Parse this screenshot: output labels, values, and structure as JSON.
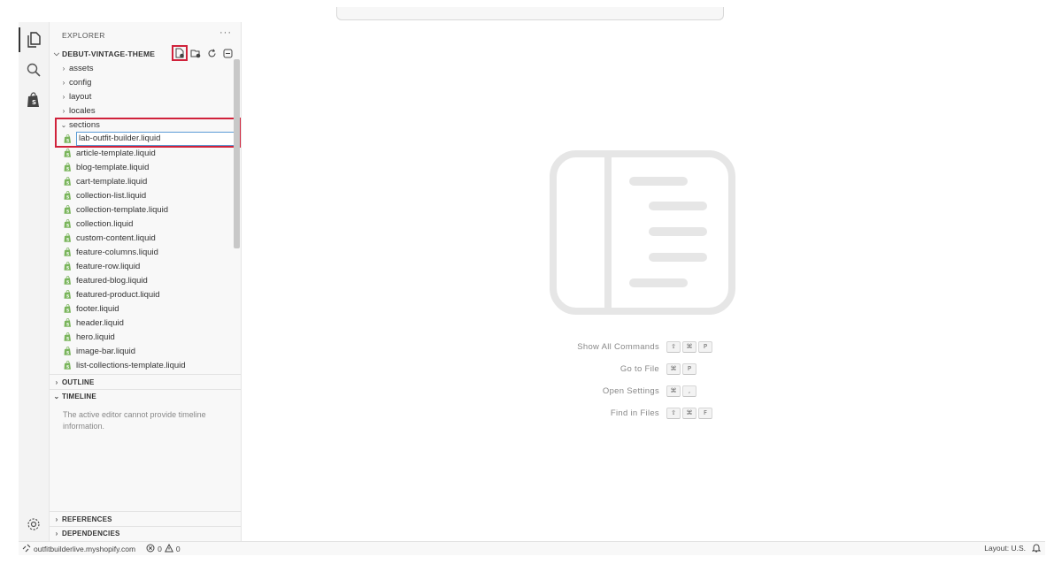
{
  "explorer": {
    "title": "EXPLORER",
    "more": "···",
    "project": "DEBUT-VINTAGE-THEME",
    "actions": [
      "new-file-icon",
      "new-folder-icon",
      "refresh-icon",
      "collapse-all-icon"
    ]
  },
  "tree": {
    "folders": [
      "assets",
      "config",
      "layout",
      "locales"
    ],
    "open_folder": "sections",
    "rename_value": "lab-outfit-builder.liquid",
    "files": [
      "article-template.liquid",
      "blog-template.liquid",
      "cart-template.liquid",
      "collection-list.liquid",
      "collection-template.liquid",
      "collection.liquid",
      "custom-content.liquid",
      "feature-columns.liquid",
      "feature-row.liquid",
      "featured-blog.liquid",
      "featured-product.liquid",
      "footer.liquid",
      "header.liquid",
      "hero.liquid",
      "image-bar.liquid",
      "list-collections-template.liquid"
    ]
  },
  "panels": {
    "outline": "OUTLINE",
    "timeline": "TIMELINE",
    "timeline_message": "The active editor cannot provide timeline information.",
    "references": "REFERENCES",
    "dependencies": "DEPENDENCIES"
  },
  "shortcuts": [
    {
      "label": "Show All Commands",
      "keys": [
        "⇧",
        "⌘",
        "P"
      ]
    },
    {
      "label": "Go to File",
      "keys": [
        "⌘",
        "P"
      ]
    },
    {
      "label": "Open Settings",
      "keys": [
        "⌘",
        ","
      ]
    },
    {
      "label": "Find in Files",
      "keys": [
        "⇧",
        "⌘",
        "F"
      ]
    }
  ],
  "status": {
    "remote": "outfitbuilderlive.myshopify.com",
    "errors": "0",
    "warnings": "0",
    "layout": "Layout: U.S."
  },
  "colors": {
    "highlight": "#d0223b",
    "liquid_icon": "#7ab55c"
  }
}
